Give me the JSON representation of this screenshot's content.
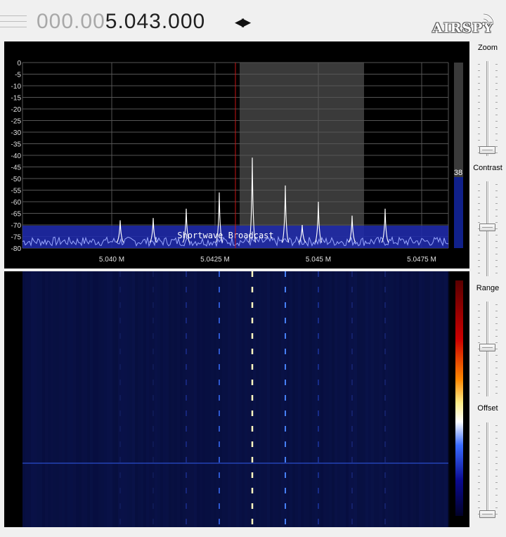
{
  "frequency": {
    "leading_digits": "000.00",
    "display": "5.043.000"
  },
  "logo": {
    "text": "AIRSPY"
  },
  "spectrum": {
    "db_labels": [
      "0",
      "-5",
      "-10",
      "-15",
      "-20",
      "-25",
      "-30",
      "-35",
      "-40",
      "-45",
      "-50",
      "-55",
      "-60",
      "-65",
      "-70",
      "-75",
      "-80"
    ],
    "freq_labels": [
      "5.040 M",
      "5.0425 M",
      "5.045 M",
      "5.0475 M"
    ],
    "band_label": "Shortwave Broadcast",
    "level_value": "38"
  },
  "controls": {
    "zoom_label": "Zoom",
    "contrast_label": "Contrast",
    "range_label": "Range",
    "offset_label": "Offset"
  },
  "colors": {
    "band": "#1f2aa8",
    "trace": "#9aa8ff",
    "peak": "#ffffff",
    "cursor": "#c81414",
    "passband": "#3a3a3a"
  }
}
